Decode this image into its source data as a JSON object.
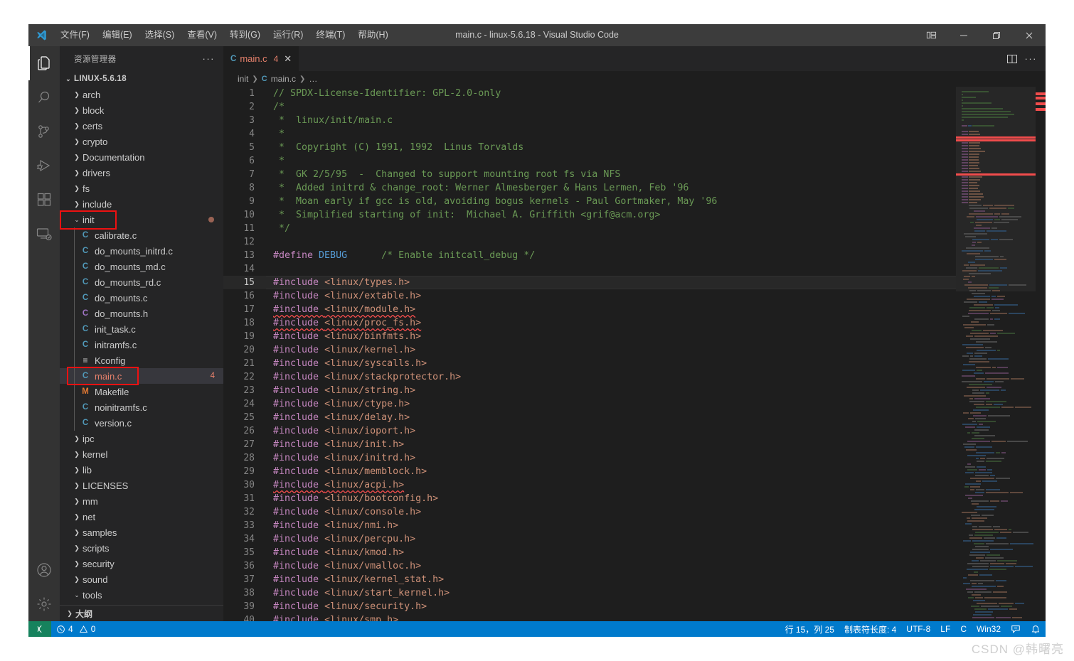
{
  "window": {
    "title": "main.c - linux-5.6.18 - Visual Studio Code",
    "logo": "vscode-logo"
  },
  "menu": {
    "items": [
      {
        "label": "文件(F)",
        "name": "menu-file"
      },
      {
        "label": "编辑(E)",
        "name": "menu-edit"
      },
      {
        "label": "选择(S)",
        "name": "menu-selection"
      },
      {
        "label": "查看(V)",
        "name": "menu-view"
      },
      {
        "label": "转到(G)",
        "name": "menu-go"
      },
      {
        "label": "运行(R)",
        "name": "menu-run"
      },
      {
        "label": "终端(T)",
        "name": "menu-terminal"
      },
      {
        "label": "帮助(H)",
        "name": "menu-help"
      }
    ]
  },
  "window_controls": {
    "layout": "customize-layout",
    "minimize": "—",
    "maximize": "❐",
    "close": "✕"
  },
  "activitybar": {
    "items": [
      {
        "name": "activity-explorer",
        "icon": "files-icon",
        "active": true
      },
      {
        "name": "activity-search",
        "icon": "search-icon",
        "active": false
      },
      {
        "name": "activity-source-control",
        "icon": "source-control-icon",
        "active": false
      },
      {
        "name": "activity-run-debug",
        "icon": "run-debug-icon",
        "active": false
      },
      {
        "name": "activity-extensions",
        "icon": "extensions-icon",
        "active": false
      },
      {
        "name": "activity-remote",
        "icon": "remote-explorer-icon",
        "active": false
      }
    ],
    "bottom": [
      {
        "name": "activity-accounts",
        "icon": "account-icon"
      },
      {
        "name": "activity-settings",
        "icon": "gear-icon"
      }
    ]
  },
  "sidebar": {
    "title": "资源管理器",
    "more_actions": "···",
    "outline_label": "大纲",
    "root": {
      "label": "LINUX-5.6.18",
      "expanded": true
    },
    "tree": [
      {
        "label": "arch",
        "type": "folder",
        "depth": 1,
        "expanded": false
      },
      {
        "label": "block",
        "type": "folder",
        "depth": 1,
        "expanded": false
      },
      {
        "label": "certs",
        "type": "folder",
        "depth": 1,
        "expanded": false
      },
      {
        "label": "crypto",
        "type": "folder",
        "depth": 1,
        "expanded": false
      },
      {
        "label": "Documentation",
        "type": "folder",
        "depth": 1,
        "expanded": false
      },
      {
        "label": "drivers",
        "type": "folder",
        "depth": 1,
        "expanded": false
      },
      {
        "label": "fs",
        "type": "folder",
        "depth": 1,
        "expanded": false
      },
      {
        "label": "include",
        "type": "folder",
        "depth": 1,
        "expanded": false
      },
      {
        "label": "init",
        "type": "folder",
        "depth": 1,
        "expanded": true,
        "modified": true,
        "highlight": true
      },
      {
        "label": "calibrate.c",
        "type": "c",
        "depth": 2
      },
      {
        "label": "do_mounts_initrd.c",
        "type": "c",
        "depth": 2
      },
      {
        "label": "do_mounts_md.c",
        "type": "c",
        "depth": 2
      },
      {
        "label": "do_mounts_rd.c",
        "type": "c",
        "depth": 2
      },
      {
        "label": "do_mounts.c",
        "type": "c",
        "depth": 2
      },
      {
        "label": "do_mounts.h",
        "type": "h",
        "depth": 2
      },
      {
        "label": "init_task.c",
        "type": "c",
        "depth": 2
      },
      {
        "label": "initramfs.c",
        "type": "c",
        "depth": 2
      },
      {
        "label": "Kconfig",
        "type": "kconfig",
        "depth": 2
      },
      {
        "label": "main.c",
        "type": "c",
        "depth": 2,
        "selected": true,
        "badge": "4",
        "highlight": true
      },
      {
        "label": "Makefile",
        "type": "makefile",
        "depth": 2
      },
      {
        "label": "noinitramfs.c",
        "type": "c",
        "depth": 2
      },
      {
        "label": "version.c",
        "type": "c",
        "depth": 2
      },
      {
        "label": "ipc",
        "type": "folder",
        "depth": 1,
        "expanded": false
      },
      {
        "label": "kernel",
        "type": "folder",
        "depth": 1,
        "expanded": false
      },
      {
        "label": "lib",
        "type": "folder",
        "depth": 1,
        "expanded": false
      },
      {
        "label": "LICENSES",
        "type": "folder",
        "depth": 1,
        "expanded": false
      },
      {
        "label": "mm",
        "type": "folder",
        "depth": 1,
        "expanded": false
      },
      {
        "label": "net",
        "type": "folder",
        "depth": 1,
        "expanded": false
      },
      {
        "label": "samples",
        "type": "folder",
        "depth": 1,
        "expanded": false
      },
      {
        "label": "scripts",
        "type": "folder",
        "depth": 1,
        "expanded": false
      },
      {
        "label": "security",
        "type": "folder",
        "depth": 1,
        "expanded": false
      },
      {
        "label": "sound",
        "type": "folder",
        "depth": 1,
        "expanded": false
      },
      {
        "label": "tools",
        "type": "folder",
        "depth": 1,
        "expanded": true
      }
    ]
  },
  "editor": {
    "tab": {
      "icon_letter": "C",
      "label": "main.c",
      "count": "4",
      "close": "✕"
    },
    "actions": {
      "split": "split-editor-icon",
      "more": "···"
    },
    "breadcrumbs": [
      {
        "label": "init",
        "name": "breadcrumb-init"
      },
      {
        "label": "main.c",
        "name": "breadcrumb-main-c",
        "icon": "C"
      },
      {
        "label": "…",
        "name": "breadcrumb-symbols"
      }
    ],
    "lines": [
      {
        "n": 1,
        "segs": [
          {
            "t": "// SPDX-License-Identifier: GPL-2.0-only",
            "c": "cmt"
          }
        ]
      },
      {
        "n": 2,
        "segs": [
          {
            "t": "/*",
            "c": "cmt"
          }
        ]
      },
      {
        "n": 3,
        "segs": [
          {
            "t": " *  linux/init/main.c",
            "c": "cmt"
          }
        ]
      },
      {
        "n": 4,
        "segs": [
          {
            "t": " *",
            "c": "cmt"
          }
        ]
      },
      {
        "n": 5,
        "segs": [
          {
            "t": " *  Copyright (C) 1991, 1992  Linus Torvalds",
            "c": "cmt"
          }
        ]
      },
      {
        "n": 6,
        "segs": [
          {
            "t": " *",
            "c": "cmt"
          }
        ]
      },
      {
        "n": 7,
        "segs": [
          {
            "t": " *  GK 2/5/95  -  Changed to support mounting root fs via NFS",
            "c": "cmt"
          }
        ]
      },
      {
        "n": 8,
        "segs": [
          {
            "t": " *  Added initrd & change_root: Werner Almesberger & Hans Lermen, Feb '96",
            "c": "cmt"
          }
        ]
      },
      {
        "n": 9,
        "segs": [
          {
            "t": " *  Moan early if gcc is old, avoiding bogus kernels - Paul Gortmaker, May '96",
            "c": "cmt"
          }
        ]
      },
      {
        "n": 10,
        "segs": [
          {
            "t": " *  Simplified starting of init:  Michael A. Griffith <grif@acm.org>",
            "c": "cmt"
          }
        ]
      },
      {
        "n": 11,
        "segs": [
          {
            "t": " */",
            "c": "cmt"
          }
        ]
      },
      {
        "n": 12,
        "segs": []
      },
      {
        "n": 13,
        "segs": [
          {
            "t": "#define ",
            "c": "pp"
          },
          {
            "t": "DEBUG",
            "c": "kw"
          },
          {
            "t": "      /* Enable initcall_debug */",
            "c": "cmt"
          }
        ]
      },
      {
        "n": 14,
        "segs": []
      },
      {
        "n": 15,
        "active": true,
        "segs": [
          {
            "t": "#include ",
            "c": "pp"
          },
          {
            "t": "<linux/types.h>",
            "c": "str"
          }
        ]
      },
      {
        "n": 16,
        "segs": [
          {
            "t": "#include ",
            "c": "pp"
          },
          {
            "t": "<linux/extable.h>",
            "c": "str"
          }
        ]
      },
      {
        "n": 17,
        "error": true,
        "segs": [
          {
            "t": "#include ",
            "c": "pp"
          },
          {
            "t": "<linux/module.h>",
            "c": "str"
          }
        ]
      },
      {
        "n": 18,
        "error": true,
        "segs": [
          {
            "t": "#include ",
            "c": "pp"
          },
          {
            "t": "<linux/proc_fs.h>",
            "c": "str"
          }
        ]
      },
      {
        "n": 19,
        "segs": [
          {
            "t": "#include ",
            "c": "pp"
          },
          {
            "t": "<linux/binfmts.h>",
            "c": "str"
          }
        ]
      },
      {
        "n": 20,
        "segs": [
          {
            "t": "#include ",
            "c": "pp"
          },
          {
            "t": "<linux/kernel.h>",
            "c": "str"
          }
        ]
      },
      {
        "n": 21,
        "segs": [
          {
            "t": "#include ",
            "c": "pp"
          },
          {
            "t": "<linux/syscalls.h>",
            "c": "str"
          }
        ]
      },
      {
        "n": 22,
        "segs": [
          {
            "t": "#include ",
            "c": "pp"
          },
          {
            "t": "<linux/stackprotector.h>",
            "c": "str"
          }
        ]
      },
      {
        "n": 23,
        "segs": [
          {
            "t": "#include ",
            "c": "pp"
          },
          {
            "t": "<linux/string.h>",
            "c": "str"
          }
        ]
      },
      {
        "n": 24,
        "segs": [
          {
            "t": "#include ",
            "c": "pp"
          },
          {
            "t": "<linux/ctype.h>",
            "c": "str"
          }
        ]
      },
      {
        "n": 25,
        "segs": [
          {
            "t": "#include ",
            "c": "pp"
          },
          {
            "t": "<linux/delay.h>",
            "c": "str"
          }
        ]
      },
      {
        "n": 26,
        "segs": [
          {
            "t": "#include ",
            "c": "pp"
          },
          {
            "t": "<linux/ioport.h>",
            "c": "str"
          }
        ]
      },
      {
        "n": 27,
        "segs": [
          {
            "t": "#include ",
            "c": "pp"
          },
          {
            "t": "<linux/init.h>",
            "c": "str"
          }
        ]
      },
      {
        "n": 28,
        "segs": [
          {
            "t": "#include ",
            "c": "pp"
          },
          {
            "t": "<linux/initrd.h>",
            "c": "str"
          }
        ]
      },
      {
        "n": 29,
        "segs": [
          {
            "t": "#include ",
            "c": "pp"
          },
          {
            "t": "<linux/memblock.h>",
            "c": "str"
          }
        ]
      },
      {
        "n": 30,
        "error": true,
        "segs": [
          {
            "t": "#include ",
            "c": "pp"
          },
          {
            "t": "<linux/acpi.h>",
            "c": "str"
          }
        ]
      },
      {
        "n": 31,
        "segs": [
          {
            "t": "#include ",
            "c": "pp"
          },
          {
            "t": "<linux/bootconfig.h>",
            "c": "str"
          }
        ]
      },
      {
        "n": 32,
        "segs": [
          {
            "t": "#include ",
            "c": "pp"
          },
          {
            "t": "<linux/console.h>",
            "c": "str"
          }
        ]
      },
      {
        "n": 33,
        "segs": [
          {
            "t": "#include ",
            "c": "pp"
          },
          {
            "t": "<linux/nmi.h>",
            "c": "str"
          }
        ]
      },
      {
        "n": 34,
        "segs": [
          {
            "t": "#include ",
            "c": "pp"
          },
          {
            "t": "<linux/percpu.h>",
            "c": "str"
          }
        ]
      },
      {
        "n": 35,
        "segs": [
          {
            "t": "#include ",
            "c": "pp"
          },
          {
            "t": "<linux/kmod.h>",
            "c": "str"
          }
        ]
      },
      {
        "n": 36,
        "segs": [
          {
            "t": "#include ",
            "c": "pp"
          },
          {
            "t": "<linux/vmalloc.h>",
            "c": "str"
          }
        ]
      },
      {
        "n": 37,
        "segs": [
          {
            "t": "#include ",
            "c": "pp"
          },
          {
            "t": "<linux/kernel_stat.h>",
            "c": "str"
          }
        ]
      },
      {
        "n": 38,
        "segs": [
          {
            "t": "#include ",
            "c": "pp"
          },
          {
            "t": "<linux/start_kernel.h>",
            "c": "str"
          }
        ]
      },
      {
        "n": 39,
        "segs": [
          {
            "t": "#include ",
            "c": "pp"
          },
          {
            "t": "<linux/security.h>",
            "c": "str"
          }
        ]
      },
      {
        "n": 40,
        "segs": [
          {
            "t": "#include ",
            "c": "pp"
          },
          {
            "t": "<linux/smp.h>",
            "c": "str"
          }
        ]
      }
    ]
  },
  "statusbar": {
    "remote_icon": "remote-window-icon",
    "errors_icon": "error-icon",
    "errors": "4",
    "warnings_icon": "warning-icon",
    "warnings": "0",
    "cursor": "行 15，列 25",
    "tabsize": "制表符长度: 4",
    "encoding": "UTF-8",
    "eol": "LF",
    "language": "C",
    "platform": "Win32",
    "feedback_icon": "feedback-icon",
    "bell_icon": "bell-icon"
  },
  "watermark": "CSDN @韩曙亮",
  "colors": {
    "accent": "#007acc",
    "error": "#f14c4c",
    "annotation": "#ee1111",
    "remote_green": "#16825d"
  }
}
